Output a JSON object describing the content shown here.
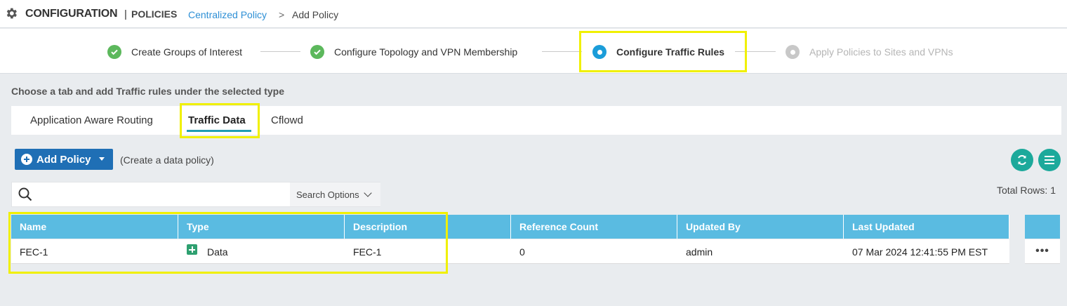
{
  "header": {
    "title": "CONFIGURATION",
    "separator": "|",
    "subtitle": "POLICIES",
    "breadcrumb_link": "Centralized Policy",
    "breadcrumb_sep": ">",
    "breadcrumb_current": "Add Policy"
  },
  "wizard": {
    "steps": [
      {
        "label": "Create Groups of Interest",
        "state": "done"
      },
      {
        "label": "Configure Topology and VPN Membership",
        "state": "done"
      },
      {
        "label": "Configure Traffic Rules",
        "state": "active"
      },
      {
        "label": "Apply Policies to Sites and VPNs",
        "state": "todo"
      }
    ]
  },
  "instruction": "Choose a tab and add Traffic rules under the selected type",
  "tabs": [
    {
      "label": "Application Aware Routing",
      "active": false
    },
    {
      "label": "Traffic Data",
      "active": true
    },
    {
      "label": "Cflowd",
      "active": false
    }
  ],
  "toolbar": {
    "add_label": "Add Policy",
    "add_hint": "(Create a data policy)"
  },
  "search": {
    "placeholder": "",
    "options_label": "Search Options"
  },
  "total_rows": "Total Rows: 1",
  "table": {
    "columns": [
      "Name",
      "Type",
      "Description",
      "Reference Count",
      "Updated By",
      "Last Updated"
    ],
    "rows": [
      {
        "name": "FEC-1",
        "type": "Data",
        "description": "FEC-1",
        "reference_count": "0",
        "updated_by": "admin",
        "last_updated": "07 Mar 2024 12:41:55 PM EST"
      }
    ],
    "row_actions": "•••"
  },
  "colors": {
    "accent_blue": "#1f6fb5",
    "table_header": "#5abbe1",
    "step_done": "#5cb85c",
    "step_active": "#1b9dd9",
    "teal_button": "#1ca99b",
    "highlight": "#f0f000"
  },
  "icons": [
    "gear-icon",
    "check-icon",
    "plus-circle-icon",
    "caret-down-icon",
    "refresh-icon",
    "menu-icon",
    "search-icon",
    "chevron-down-icon",
    "data-policy-icon",
    "more-icon"
  ]
}
